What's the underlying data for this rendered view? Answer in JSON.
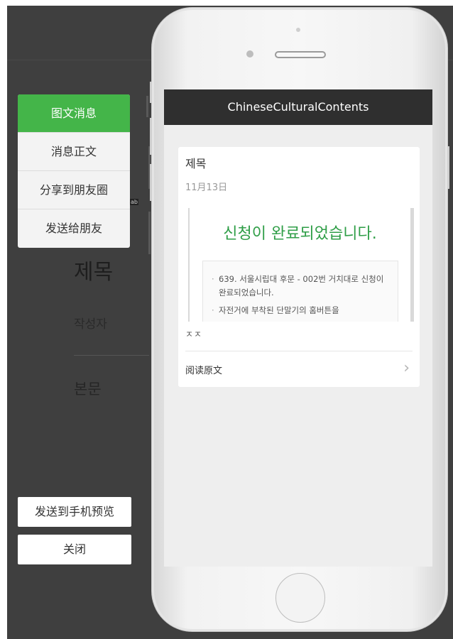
{
  "editor": {
    "title_ghost": "제목",
    "author_ghost": "작성자",
    "body_ghost": "본문",
    "ab_badge": "ab"
  },
  "menu": {
    "items": [
      {
        "label": "图文消息",
        "active": true
      },
      {
        "label": "消息正文",
        "active": false
      },
      {
        "label": "分享到朋友圈",
        "active": false
      },
      {
        "label": "发送给朋友",
        "active": false
      }
    ]
  },
  "actions": {
    "send_preview": "发送到手机预览",
    "close": "关闭"
  },
  "phone": {
    "nav_title": "ChineseCulturalContents",
    "article": {
      "title": "제목",
      "date": "11月13日",
      "preview_heading": "신청이 완료되었습니다.",
      "preview_items": [
        "639. 서울시립대 후문 - 002번 거치대로 신청이 완료되었습니다.",
        "자전거에 부착된 단말기의 홈버튼을"
      ],
      "cutoff_text": "ㅈㅈ",
      "read_original": "阅读原文"
    }
  },
  "icons": {
    "chevron": "chevron-right-icon"
  },
  "colors": {
    "accent_green": "#44b549",
    "nav_bar": "#2f2f2f",
    "heading_green": "#2f9e47"
  }
}
